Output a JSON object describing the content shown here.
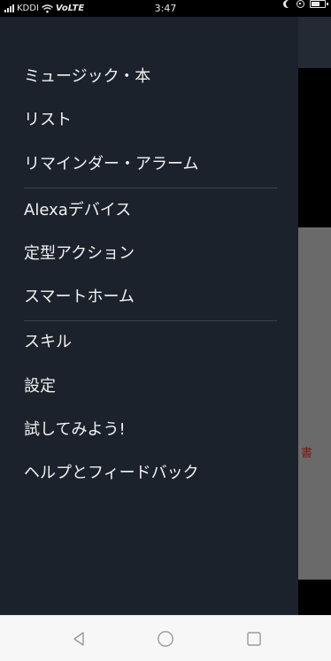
{
  "status_bar": {
    "carrier": "KDDI",
    "network": "VoLTE",
    "time": "3:47"
  },
  "menu": {
    "section1": [
      "ミュージック・本",
      "リスト",
      "リマインダー・アラーム"
    ],
    "section2": [
      "Alexaデバイス",
      "定型アクション",
      "スマートホーム"
    ],
    "section3": [
      "スキル",
      "設定",
      "試してみよう!",
      "ヘルプとフィードバック"
    ]
  },
  "background_app": {
    "partial_text": "書"
  },
  "nav_bar": {
    "icons": [
      "back-icon",
      "home-icon",
      "recents-icon"
    ]
  },
  "colors": {
    "drawer_bg": "#1b222b",
    "text": "#f2f2f2",
    "divider": "#3a424c",
    "nav_bg": "#f7f7f7"
  }
}
